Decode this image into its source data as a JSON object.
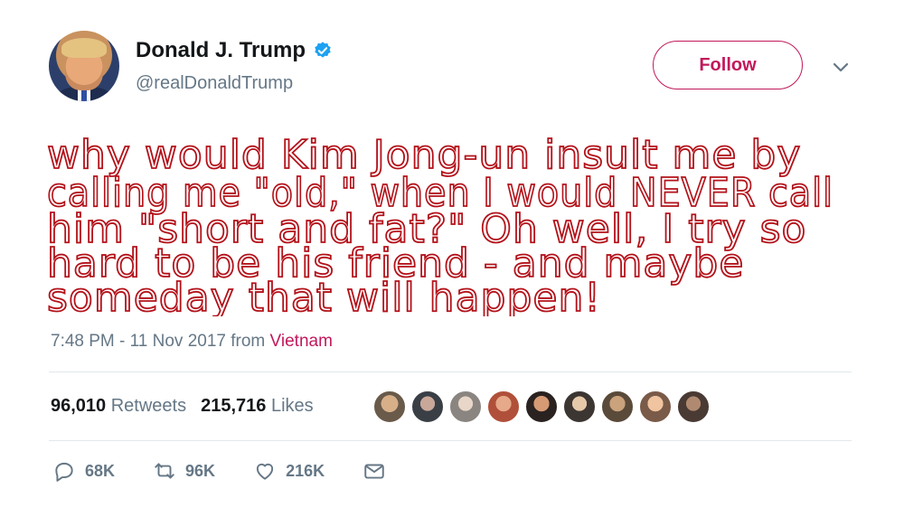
{
  "tweet": {
    "display_name": "Donald J. Trump",
    "handle": "@realDonaldTrump",
    "follow_label": "Follow",
    "handwritten_lines": [
      "why would Kim Jong-un insult me by",
      "calling me \"old,\" when I would NEVER call",
      "him \"short and fat?\" Oh well, I try so",
      "hard to be his friend - and maybe",
      "someday that will happen!"
    ],
    "timestamp": "7:48 PM - 11 Nov 2017 from ",
    "location": "Vietnam",
    "retweets_count": "96,010",
    "retweets_label": "Retweets",
    "likes_count": "215,716",
    "likes_label": "Likes",
    "replies_count": "68K",
    "retweet_action_count": "96K",
    "like_action_count": "216K"
  },
  "colors": {
    "accent": "#c2185b",
    "handwriting": "#b3121a",
    "verified": "#1da1f2",
    "muted": "#657786"
  },
  "icons": [
    "verified-icon",
    "chevron-down-icon",
    "reply-icon",
    "retweet-icon",
    "like-icon",
    "message-icon"
  ]
}
